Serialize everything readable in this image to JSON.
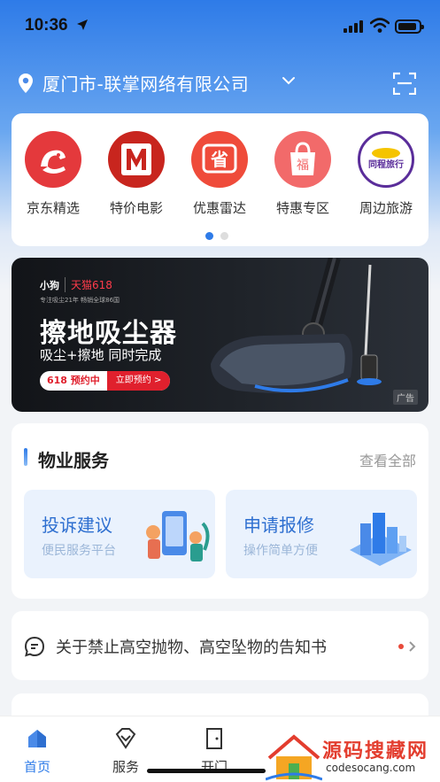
{
  "status": {
    "time": "10:36"
  },
  "header": {
    "location": "厦门市-联掌网络有限公司"
  },
  "quick_nav": [
    {
      "label": "京东精选",
      "color": "#e4393c",
      "icon": "jd-dog-icon"
    },
    {
      "label": "特价电影",
      "color": "#c8251e",
      "icon": "movie-m-icon",
      "glyph": "M"
    },
    {
      "label": "优惠雷达",
      "color": "#ef4b3a",
      "icon": "discount-icon",
      "glyph": "省"
    },
    {
      "label": "特惠专区",
      "color": "#f26a6a",
      "icon": "gift-bag-icon",
      "glyph": "福"
    },
    {
      "label": "周边旅游",
      "color": "#5a2d9a",
      "icon": "travel-icon",
      "glyph": "同程旅行"
    }
  ],
  "banner": {
    "brand": "小狗",
    "tmall": "天猫618",
    "brand_sub": "专注吸尘21年 畅销全球86国",
    "title": "擦地吸尘器",
    "subtitle": "吸尘+擦地 同时完成",
    "promo_a": "618 预约中",
    "promo_b": "立即预约 >",
    "ad": "广告"
  },
  "service": {
    "title": "物业服务",
    "view_all": "查看全部",
    "items": [
      {
        "name": "投诉建议",
        "desc": "便民服务平台"
      },
      {
        "name": "申请报修",
        "desc": "操作简单方便"
      }
    ]
  },
  "notice": {
    "text": "关于禁止高空抛物、高空坠物的告知书"
  },
  "tabs": [
    {
      "label": "首页",
      "active": true
    },
    {
      "label": "服务"
    },
    {
      "label": "开门"
    }
  ],
  "watermark": {
    "title": "源码搜藏网",
    "url": "codesocang.com"
  },
  "colors": {
    "accent": "#2e7be8",
    "notice_dot": "#e84a3a"
  }
}
